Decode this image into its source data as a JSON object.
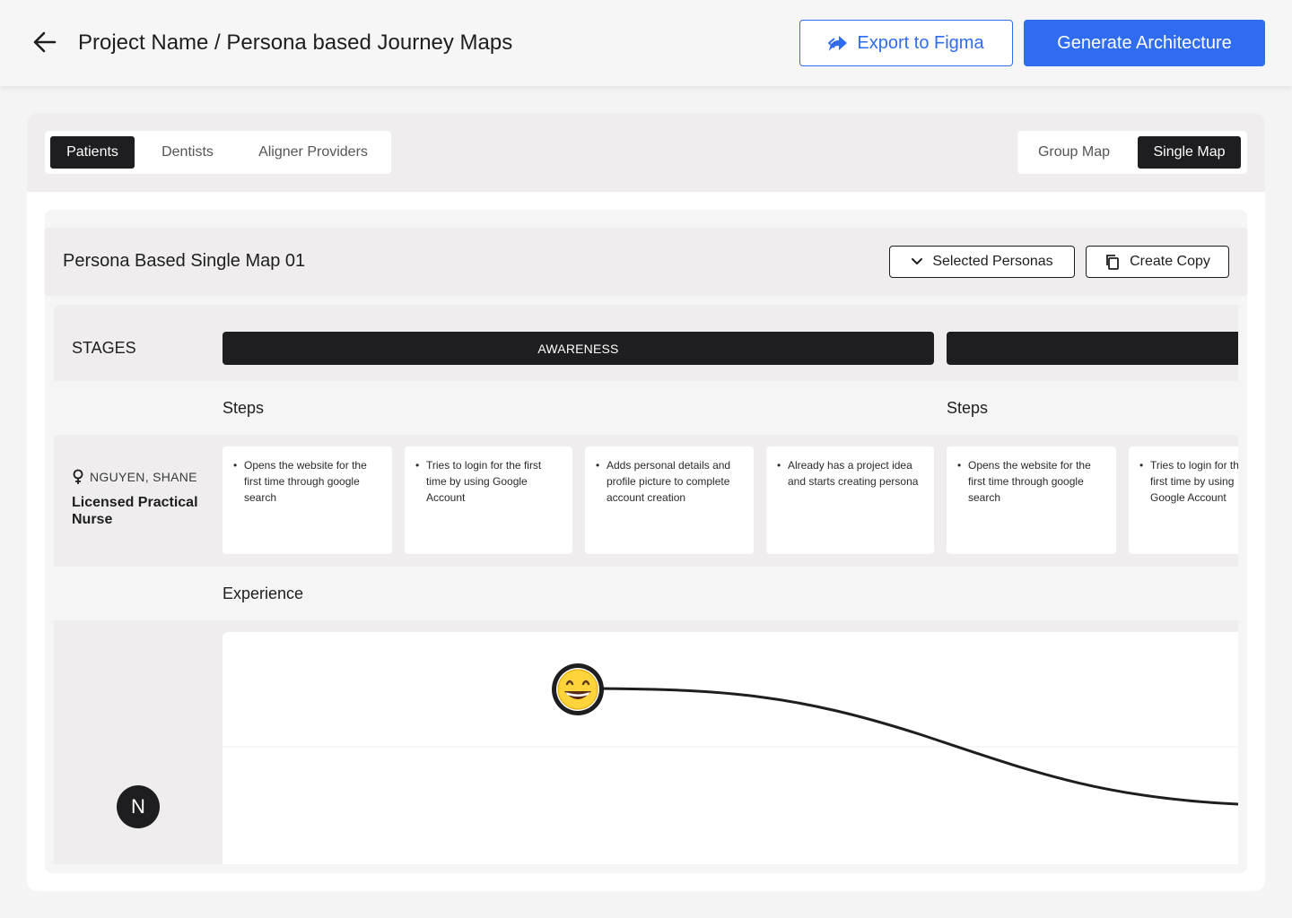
{
  "header": {
    "title": "Project Name / Persona based Journey Maps",
    "export_label": "Export to Figma",
    "generate_label": "Generate Architecture"
  },
  "persona_tabs": [
    "Patients",
    "Dentists",
    "Aligner Providers"
  ],
  "active_persona_tab": "Patients",
  "view_toggle": [
    "Group Map",
    "Single Map"
  ],
  "active_view": "Single Map",
  "map": {
    "title": "Persona Based Single Map 01",
    "selected_personas_label": "Selected Personas",
    "create_copy_label": "Create Copy"
  },
  "grid": {
    "stages_label": "STAGES",
    "stages": [
      {
        "name": "AWARENESS"
      },
      {
        "name": ""
      }
    ],
    "steps_label": "Steps",
    "experience_label": "Experience",
    "persona": {
      "name": "NGUYEN, SHANE",
      "role": "Licensed Practical Nurse",
      "initial": "N",
      "gender_icon": "female-icon"
    },
    "steps": [
      "Opens the website for the first time through google search",
      "Tries to login for the first time by using Google Account",
      "Adds personal details and profile picture to complete account creation",
      "Already has a project idea and starts creating persona",
      "Opens the website for the first time through google search",
      "Tries to login for the first time by using Google Account"
    ],
    "experience": {
      "emotion_icon": "grinning-face-icon",
      "emoji": "😄"
    }
  },
  "colors": {
    "primary": "#2f6cf2",
    "dark": "#1e1e20",
    "band": "#efeded",
    "surface": "#f6f5f5"
  }
}
